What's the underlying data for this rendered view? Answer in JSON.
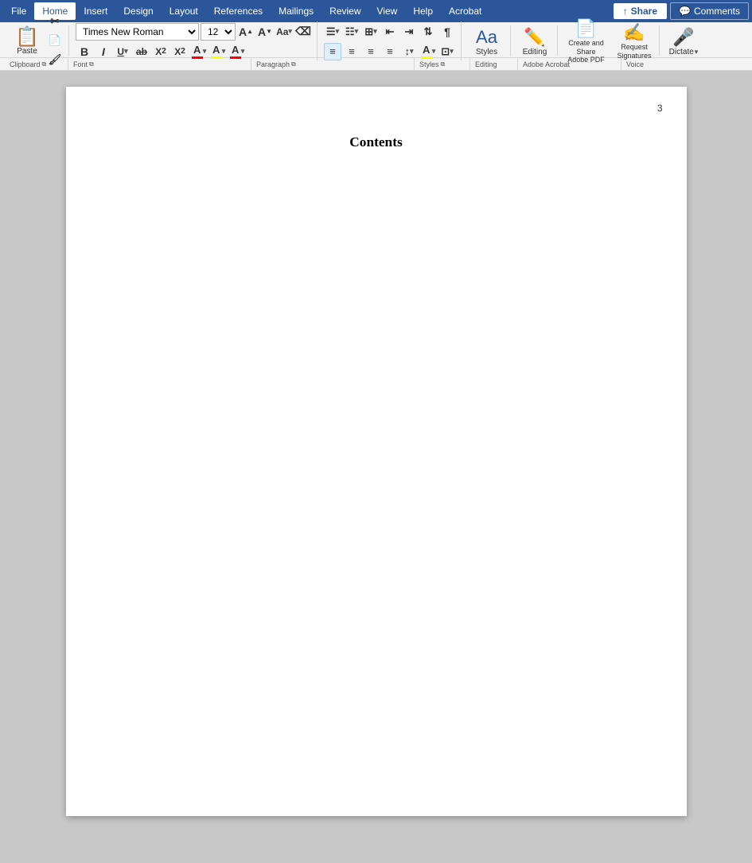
{
  "menubar": {
    "items": [
      "File",
      "Home",
      "Insert",
      "Design",
      "Layout",
      "References",
      "Mailings",
      "Review",
      "View",
      "Help",
      "Acrobat"
    ],
    "active_item": "Home",
    "share_label": "Share",
    "comments_label": "Comments"
  },
  "ribbon": {
    "font": {
      "family": "Times New Roman",
      "size": "12",
      "bold": "B",
      "italic": "I",
      "underline": "U",
      "strikethrough": "ab",
      "subscript": "X₂",
      "superscript": "X²",
      "clear_format": "A",
      "section_label": "Font",
      "expand_icon": "⧉"
    },
    "clipboard": {
      "paste_label": "Paste",
      "cut_label": "Cut",
      "copy_label": "Copy",
      "format_painter": "🖌",
      "section_label": "Clipboard",
      "expand_icon": "⧉"
    },
    "paragraph": {
      "bullets_label": "Bullets",
      "numbering_label": "Numbering",
      "multi_level": "Multi",
      "decrease_indent": "←",
      "increase_indent": "→",
      "align_left": "≡",
      "align_center": "≡",
      "align_right": "≡",
      "justify": "≡",
      "line_spacing": "↕",
      "shading": "A",
      "borders": "⊞",
      "sort": "↕",
      "show_formatting": "¶",
      "section_label": "Paragraph",
      "expand_icon": "⧉"
    },
    "styles": {
      "label": "Styles",
      "expand_icon": "⧉"
    },
    "editing": {
      "label": "Editing"
    },
    "adobe_acrobat": {
      "create_share_label": "Create and Share\nAdobe PDF",
      "request_signatures_label": "Request\nSignatures",
      "section_label": "Adobe Acrobat"
    },
    "voice": {
      "dictate_label": "Dictate",
      "section_label": "Voice"
    }
  },
  "document": {
    "page_number": "3",
    "contents_title": "Contents"
  }
}
